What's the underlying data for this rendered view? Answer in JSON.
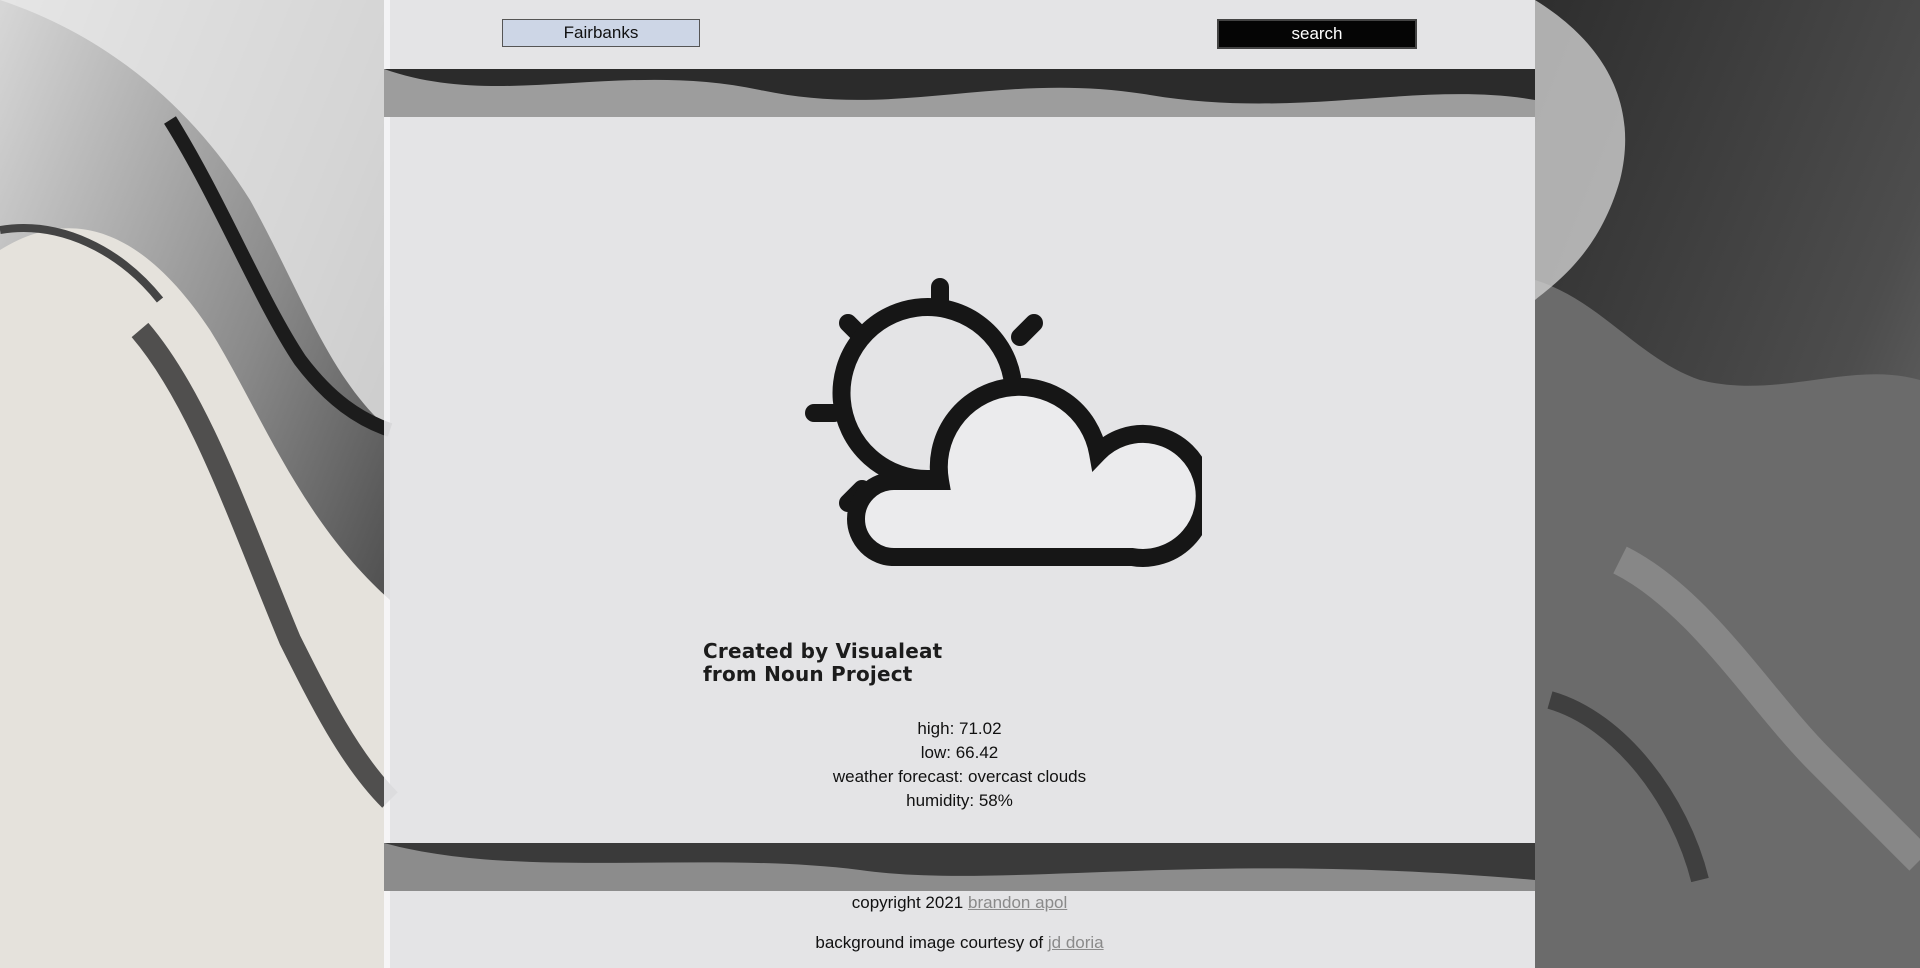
{
  "search": {
    "city_value": "Fairbanks",
    "button_label": "search"
  },
  "icon": {
    "name": "partly-cloudy-icon",
    "credit_line1": "Created by Visualeat",
    "credit_line2": "from Noun Project"
  },
  "weather": {
    "high": "high: 71.02",
    "low": "low: 66.42",
    "forecast": "weather forecast: overcast clouds",
    "humidity": "humidity: 58%"
  },
  "footer": {
    "copyright_text": "copyright 2021",
    "author_link": "brandon apol",
    "bg_text": "background image courtesy of",
    "bg_link": "jd doria"
  },
  "colors": {
    "panel": "#f8f8fa",
    "button_bg": "#050505",
    "input_bg": "#cdd6e6",
    "link": "#8a8a8a"
  }
}
